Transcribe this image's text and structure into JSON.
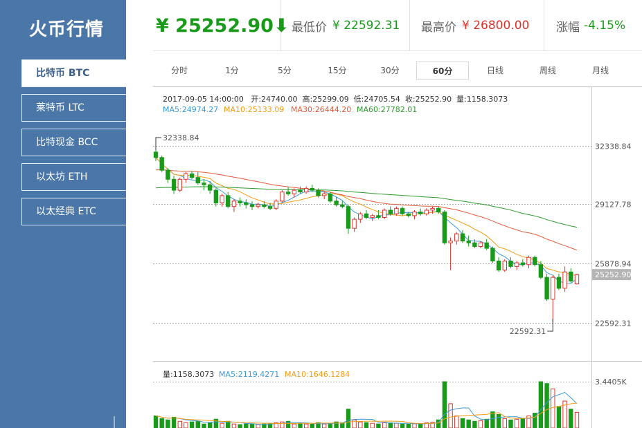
{
  "app": {
    "title": "火币行情"
  },
  "sidebar": {
    "items": [
      {
        "label": "比特币 BTC",
        "active": true
      },
      {
        "label": "莱特币 LTC",
        "active": false
      },
      {
        "label": "比特现金 BCC",
        "active": false
      },
      {
        "label": "以太坊 ETH",
        "active": false
      },
      {
        "label": "以太经典 ETC",
        "active": false
      }
    ]
  },
  "header": {
    "price": "¥ 25252.90",
    "low_label": "最低价",
    "low_value": "¥ 22592.31",
    "high_label": "最高价",
    "high_value": "¥ 26800.00",
    "change_label": "涨幅",
    "change_value": "-4.15%"
  },
  "tabs": [
    {
      "label": "分时",
      "active": false
    },
    {
      "label": "1分",
      "active": false
    },
    {
      "label": "5分",
      "active": false
    },
    {
      "label": "15分",
      "active": false
    },
    {
      "label": "30分",
      "active": false
    },
    {
      "label": "60分",
      "active": true
    },
    {
      "label": "日线",
      "active": false
    },
    {
      "label": "周线",
      "active": false
    },
    {
      "label": "月线",
      "active": false
    }
  ],
  "info": {
    "line1": "2017-09-05 14:00:00   开:24740.00  高:25299.09  低:24705.54  收:25252.90  量:1158.3073",
    "ma5": "MA5:24974.27",
    "ma10": "MA10:25133.09",
    "ma30": "MA30:26444.20",
    "ma60": "MA60:27782.01"
  },
  "volume_info": {
    "vol": "量:1158.3073",
    "ma5": "MA5:2119.4271",
    "ma10": "MA10:1646.1284",
    "axis_label": "3.4405K"
  },
  "chart_data": {
    "type": "candlestick",
    "y_ticks": [
      32338.84,
      29127.78,
      25878.94,
      22592.31
    ],
    "ylim": [
      22592.31,
      32338.84
    ],
    "max_label": "32338.84",
    "min_label": "22592.31",
    "last_price_label": "25252.90",
    "colors": {
      "up": "#e0302a",
      "down": "#1a9a1a",
      "ma5": "#3a9ad9",
      "ma10": "#f39c12",
      "ma30": "#e05a3a",
      "ma60": "#2e9a2e"
    },
    "candles": [
      [
        32000,
        32338.84,
        31500,
        31700
      ],
      [
        31700,
        31800,
        30900,
        31000
      ],
      [
        31000,
        31100,
        30300,
        30500
      ],
      [
        30500,
        30700,
        29700,
        29900
      ],
      [
        29900,
        30600,
        29800,
        30500
      ],
      [
        30500,
        30900,
        30300,
        30800
      ],
      [
        30800,
        30950,
        30500,
        30600
      ],
      [
        30600,
        30900,
        30200,
        30300
      ],
      [
        30300,
        30500,
        29900,
        30200
      ],
      [
        30200,
        30400,
        29700,
        29900
      ],
      [
        29900,
        30000,
        29000,
        29200
      ],
      [
        29200,
        29700,
        29000,
        29600
      ],
      [
        29600,
        29800,
        28900,
        29000
      ],
      [
        29000,
        29400,
        28700,
        29300
      ],
      [
        29300,
        29500,
        29000,
        29200
      ],
      [
        29200,
        29400,
        28900,
        29100
      ],
      [
        29100,
        29300,
        28800,
        29000
      ],
      [
        29000,
        29200,
        28900,
        29100
      ],
      [
        29100,
        29300,
        28900,
        29000
      ],
      [
        29000,
        29200,
        28800,
        28900
      ],
      [
        28900,
        29400,
        28800,
        29300
      ],
      [
        29300,
        29900,
        29200,
        29800
      ],
      [
        29800,
        30100,
        29600,
        29700
      ],
      [
        29700,
        30000,
        29500,
        29900
      ],
      [
        29900,
        30100,
        29700,
        29800
      ],
      [
        29800,
        30100,
        29700,
        30000
      ],
      [
        30000,
        30200,
        29800,
        29900
      ],
      [
        29900,
        30000,
        29500,
        29600
      ],
      [
        29600,
        29800,
        29400,
        29700
      ],
      [
        29700,
        29800,
        29200,
        29300
      ],
      [
        29300,
        29500,
        29000,
        29100
      ],
      [
        29100,
        29300,
        28900,
        29000
      ],
      [
        29000,
        29100,
        27500,
        27800
      ],
      [
        27800,
        28400,
        27600,
        28300
      ],
      [
        28300,
        28700,
        28100,
        28600
      ],
      [
        28600,
        28800,
        28300,
        28400
      ],
      [
        28400,
        28600,
        28200,
        28500
      ],
      [
        28500,
        28800,
        28300,
        28400
      ],
      [
        28400,
        28900,
        28300,
        28800
      ],
      [
        28800,
        29000,
        28500,
        28600
      ],
      [
        28600,
        29000,
        28500,
        28900
      ],
      [
        28900,
        29000,
        28500,
        28600
      ],
      [
        28600,
        28700,
        28400,
        28500
      ],
      [
        28500,
        28800,
        28300,
        28700
      ],
      [
        28700,
        28900,
        28500,
        28600
      ],
      [
        28600,
        28900,
        28500,
        28800
      ],
      [
        28800,
        29000,
        28600,
        28900
      ],
      [
        28900,
        29000,
        28600,
        28700
      ],
      [
        28700,
        28800,
        26900,
        27000
      ],
      [
        27000,
        27300,
        25500,
        27100
      ],
      [
        27100,
        27600,
        26900,
        27500
      ],
      [
        27500,
        27700,
        27000,
        27100
      ],
      [
        27100,
        27400,
        26800,
        27000
      ],
      [
        27000,
        27200,
        26700,
        26800
      ],
      [
        26800,
        27100,
        26700,
        27000
      ],
      [
        27000,
        27200,
        26600,
        26700
      ],
      [
        26700,
        26800,
        25900,
        26000
      ],
      [
        26000,
        26200,
        25400,
        25500
      ],
      [
        25500,
        26100,
        25400,
        26000
      ],
      [
        26000,
        26200,
        25600,
        25700
      ],
      [
        25700,
        26000,
        25500,
        25900
      ],
      [
        25900,
        26100,
        25700,
        25800
      ],
      [
        25800,
        26300,
        25600,
        26200
      ],
      [
        26200,
        26300,
        25700,
        25800
      ],
      [
        25800,
        26000,
        25000,
        25100
      ],
      [
        25100,
        25300,
        23800,
        23900
      ],
      [
        23900,
        25200,
        22592.31,
        25100
      ],
      [
        25100,
        25300,
        24400,
        24500
      ],
      [
        24500,
        25700,
        24300,
        25400
      ],
      [
        25400,
        25600,
        24800,
        24900
      ],
      [
        24740,
        25299.09,
        24705.54,
        25252.9
      ]
    ],
    "volumes": [
      900,
      700,
      600,
      800,
      500,
      400,
      450,
      500,
      300,
      400,
      650,
      350,
      500,
      300,
      250,
      300,
      280,
      260,
      300,
      350,
      400,
      450,
      500,
      300,
      350,
      300,
      280,
      400,
      300,
      350,
      450,
      380,
      1400,
      600,
      450,
      400,
      350,
      300,
      420,
      380,
      350,
      300,
      280,
      320,
      300,
      380,
      420,
      600,
      3440,
      1800,
      900,
      700,
      600,
      500,
      550,
      650,
      1200,
      1000,
      700,
      600,
      650,
      700,
      900,
      1100,
      3440,
      3300,
      2900,
      1600,
      2000,
      1400,
      1158
    ]
  }
}
